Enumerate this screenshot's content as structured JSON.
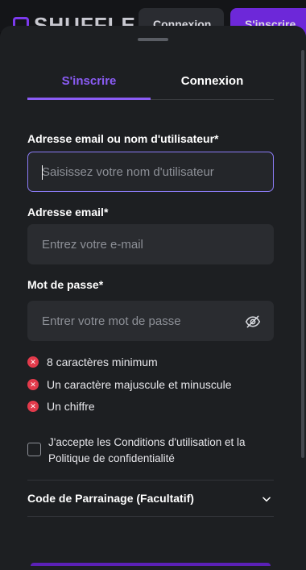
{
  "background_header": {
    "logo_text": "SHUFFLE",
    "button_left_label": "Connexion",
    "button_right_label": "S'inscrire"
  },
  "tabs": [
    {
      "label": "S'inscrire",
      "active": true
    },
    {
      "label": "Connexion",
      "active": false
    }
  ],
  "form": {
    "username": {
      "label": "Adresse email ou nom d'utilisateur*",
      "placeholder": "Saisissez votre nom d'utilisateur",
      "value": ""
    },
    "email": {
      "label": "Adresse email*",
      "placeholder": "Entrez votre e-mail",
      "value": ""
    },
    "password": {
      "label": "Mot de passe*",
      "placeholder": "Entrer votre mot de passe",
      "value": ""
    }
  },
  "password_requirements": [
    {
      "text": "8 caractères minimum",
      "status": "error"
    },
    {
      "text": "Un caractère majuscule et minuscule",
      "status": "error"
    },
    {
      "text": "Un chiffre",
      "status": "error"
    }
  ],
  "terms_label": "J'accepte les Conditions d'utilisation et la Politique de confidentialité",
  "terms_checked": false,
  "referral_label": "Code de Parrainage (Facultatif)",
  "colors": {
    "accent": "#8b5cf6",
    "sheet_background": "#1d1f22",
    "field_background": "#2a2c30",
    "error": "#e23a4b"
  },
  "icons": {
    "eye": "eye-off-icon",
    "requirement": "x-circle-icon",
    "referral_toggle": "chevron-down-icon"
  }
}
